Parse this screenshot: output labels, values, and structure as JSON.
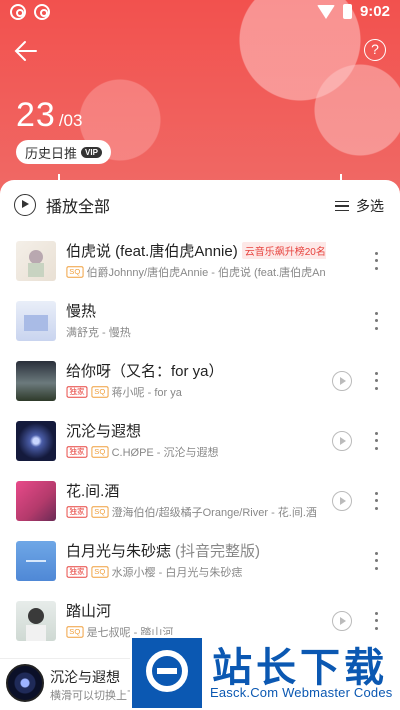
{
  "status_bar": {
    "time": "9:02",
    "icons": [
      "netease-icon",
      "netease-icon",
      "wifi-icon",
      "battery-icon"
    ]
  },
  "header": {
    "back_icon": "arrow-left-icon",
    "help_icon": "question-icon",
    "help_label": "?",
    "date_day": "23",
    "date_month": "/03",
    "history_label": "历史日推",
    "vip_label": "VIP"
  },
  "toolbar": {
    "play_all_label": "播放全部",
    "multi_select_label": "多选"
  },
  "songs": [
    {
      "title": "伯虎说 (feat.唐伯虎Annie)",
      "title_extra": "",
      "rank_badge": "云音乐飙升榜20名",
      "tags": [
        "SQ"
      ],
      "artist": "伯爵Johnny/唐伯虎Annie - 伯虎说 (feat.唐伯虎Annie)",
      "has_mv": false
    },
    {
      "title": "慢热",
      "title_extra": "",
      "rank_badge": "",
      "tags": [],
      "artist": "满舒克 - 慢热",
      "has_mv": false
    },
    {
      "title": "给你呀（又名：for ya）",
      "title_extra": "",
      "rank_badge": "",
      "tags": [
        "独家",
        "SQ"
      ],
      "artist": "蒋小呢 - for ya",
      "has_mv": true
    },
    {
      "title": "沉沦与遐想",
      "title_extra": "",
      "rank_badge": "",
      "tags": [
        "独家",
        "SQ"
      ],
      "artist": "C.HØPE - 沉沦与遐想",
      "has_mv": true
    },
    {
      "title": "花.间.酒",
      "title_extra": "",
      "rank_badge": "",
      "tags": [
        "独家",
        "SQ"
      ],
      "artist": "澄海伯伯/超级橘子Orange/River - 花.间.酒",
      "has_mv": true
    },
    {
      "title": "白月光与朱砂痣",
      "title_extra": "(抖音完整版)",
      "rank_badge": "",
      "tags": [
        "独家",
        "SQ"
      ],
      "artist": "水源小樱 - 白月光与朱砂痣",
      "has_mv": false
    },
    {
      "title": "踏山河",
      "title_extra": "",
      "rank_badge": "",
      "tags": [
        "SQ"
      ],
      "artist": "是七叔呢 - 踏山河",
      "has_mv": true
    }
  ],
  "mini_player": {
    "title": "沉沦与遐想",
    "subtitle": "横滑可以切换上下首哦"
  },
  "watermark": {
    "title": "站长下载",
    "subtitle": "Easck.Com Webmaster Codes"
  },
  "colors": {
    "accent": "#f2514e",
    "tag_exclusive": "#e7433e",
    "tag_sq": "#f09e3a",
    "watermark_blue": "#0b58b2"
  }
}
